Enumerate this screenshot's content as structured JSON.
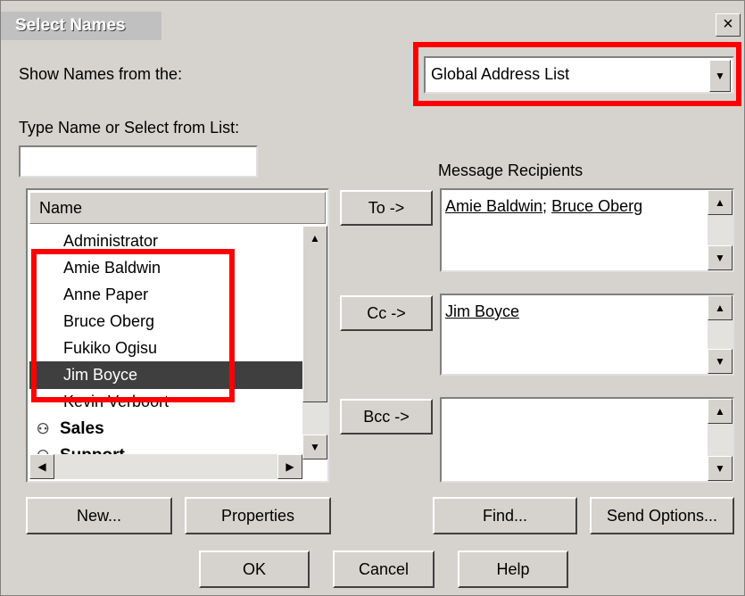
{
  "window": {
    "title": "Select Names",
    "close_glyph": "×"
  },
  "show_names": {
    "label": "Show Names from the:",
    "selected": "Global Address List"
  },
  "type_name": {
    "label": "Type Name or Select from List:",
    "value": ""
  },
  "list": {
    "column_header": "Name",
    "items": [
      {
        "label": "Administrator"
      },
      {
        "label": "Amie Baldwin"
      },
      {
        "label": "Anne Paper"
      },
      {
        "label": "Bruce Oberg"
      },
      {
        "label": "Fukiko Ogisu"
      },
      {
        "label": "Jim Boyce",
        "selected": true
      },
      {
        "label": "Kevin Verboort"
      },
      {
        "label": "Sales",
        "group": true,
        "icon": "group-icon"
      },
      {
        "label": "Support",
        "group": true,
        "icon": "group-icon"
      }
    ]
  },
  "recipients": {
    "label": "Message Recipients",
    "to_button": "To ->",
    "cc_button": "Cc ->",
    "bcc_button": "Bcc ->",
    "to": [
      "Amie Baldwin",
      "Bruce Oberg"
    ],
    "to_separator": "; ",
    "cc": [
      "Jim Boyce"
    ],
    "bcc": []
  },
  "buttons": {
    "new": "New...",
    "properties": "Properties",
    "find": "Find...",
    "send_options": "Send Options...",
    "ok": "OK",
    "cancel": "Cancel",
    "help": "Help"
  },
  "highlight_color": "#ff0000",
  "selection_color": "#3f3f3f"
}
